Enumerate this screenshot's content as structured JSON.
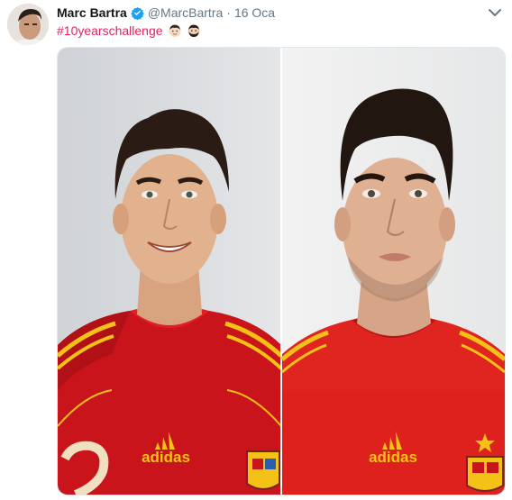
{
  "tweet": {
    "author_name": "Marc Bartra",
    "handle": "@MarcBartra",
    "separator": "·",
    "date": "16 Oca",
    "hashtag": "#10yearschallenge",
    "emojis": [
      "young-man-face-emoji",
      "bearded-man-face-emoji"
    ]
  },
  "media": {
    "left_photo": {
      "shirt_logo": "adidas"
    },
    "right_photo": {
      "shirt_logo": "adidas"
    }
  },
  "colors": {
    "hashtag": "#e0245e",
    "verified_badge": "#1da1f2",
    "shirt_red": "#d3181b",
    "shirt_trim_yellow": "#f4c116"
  }
}
